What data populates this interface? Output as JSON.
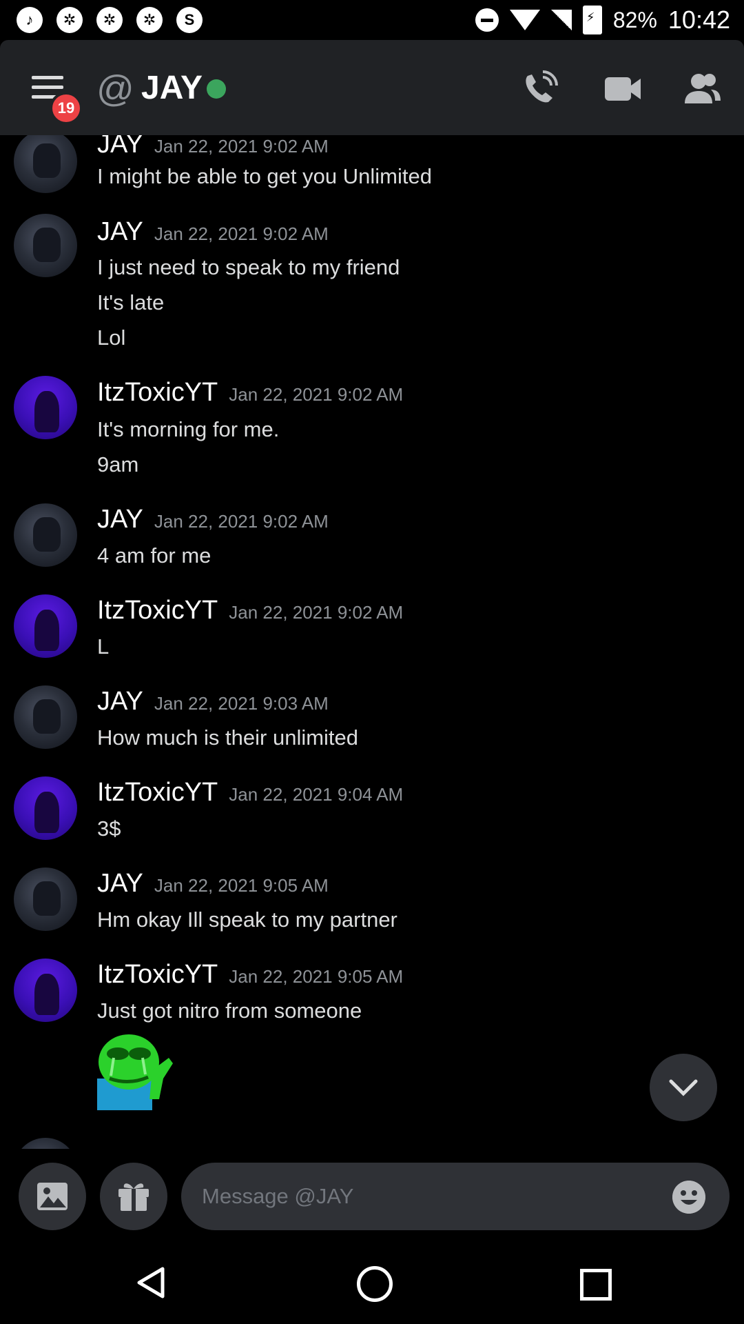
{
  "status_bar": {
    "battery": "82%",
    "time": "10:42"
  },
  "header": {
    "badge_count": "19",
    "at_symbol": "@",
    "title": "JAY",
    "online_color": "#3ba55d"
  },
  "messages": [
    {
      "author": "JAY",
      "timestamp": "Jan 22, 2021 9:02 AM",
      "lines": [
        "I might be able to get you Unlimited"
      ],
      "avatar": "jay"
    },
    {
      "author": "JAY",
      "timestamp": "Jan 22, 2021 9:02 AM",
      "lines": [
        "I just need to speak to my friend",
        "It's late",
        "Lol"
      ],
      "avatar": "jay"
    },
    {
      "author": "ItzToxicYT",
      "timestamp": "Jan 22, 2021 9:02 AM",
      "lines": [
        "It's morning for me.",
        "9am"
      ],
      "avatar": "toxic"
    },
    {
      "author": "JAY",
      "timestamp": "Jan 22, 2021 9:02 AM",
      "lines": [
        "4 am for me"
      ],
      "avatar": "jay"
    },
    {
      "author": "ItzToxicYT",
      "timestamp": "Jan 22, 2021 9:02 AM",
      "lines": [
        "L"
      ],
      "avatar": "toxic"
    },
    {
      "author": "JAY",
      "timestamp": "Jan 22, 2021 9:03 AM",
      "lines": [
        "How much is their unlimited"
      ],
      "avatar": "jay"
    },
    {
      "author": "ItzToxicYT",
      "timestamp": "Jan 22, 2021 9:04 AM",
      "lines": [
        "3$"
      ],
      "avatar": "toxic"
    },
    {
      "author": "JAY",
      "timestamp": "Jan 22, 2021 9:05 AM",
      "lines": [
        "Hm okay Ill speak to my partner"
      ],
      "avatar": "jay"
    },
    {
      "author": "ItzToxicYT",
      "timestamp": "Jan 22, 2021 9:05 AM",
      "lines": [
        "Just got nitro from someone"
      ],
      "avatar": "toxic",
      "sticker": "pepe-crying-emoji"
    }
  ],
  "composer": {
    "placeholder": "Message @JAY"
  },
  "colors": {
    "background": "#000000",
    "header": "#202225",
    "input": "#2f3136",
    "badge": "#ed4245"
  }
}
